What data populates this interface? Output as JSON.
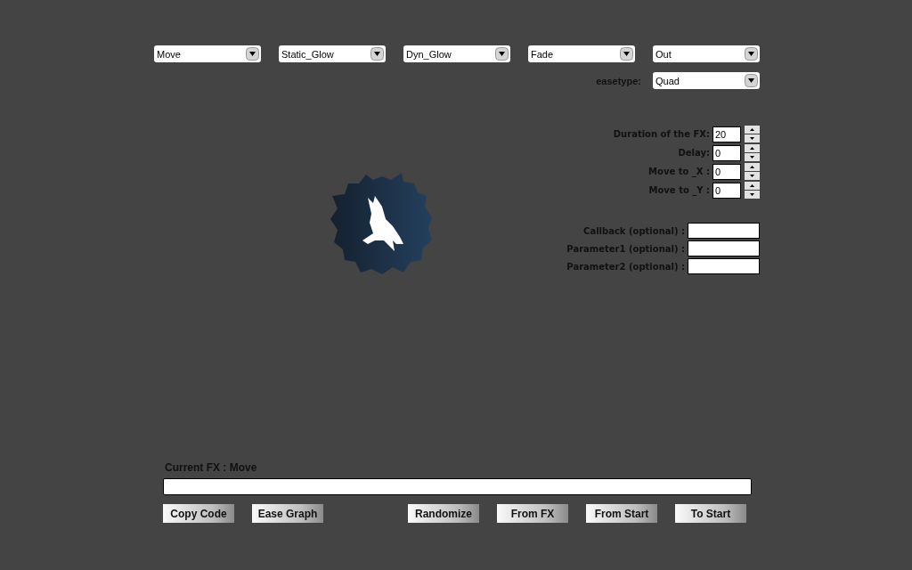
{
  "dropdowns": [
    {
      "value": "Move"
    },
    {
      "value": "Static_Glow"
    },
    {
      "value": "Dyn_Glow"
    },
    {
      "value": "Fade"
    },
    {
      "value": "Out"
    }
  ],
  "easetype": {
    "label": "easetype:",
    "value": "Quad"
  },
  "spinners": [
    {
      "label": "Duration of the FX:",
      "value": "20"
    },
    {
      "label": "Delay:",
      "value": "0"
    },
    {
      "label": "Move to _X :",
      "value": "0"
    },
    {
      "label": "Move to _Y :",
      "value": "0"
    }
  ],
  "optional_fields": [
    {
      "label": "Callback (optional) :"
    },
    {
      "label": "Parameter1 (optional) :"
    },
    {
      "label": "Parameter2 (optional) :"
    }
  ],
  "current_fx": "Current FX : Move",
  "buttons_left": [
    "Copy Code",
    "Ease Graph"
  ],
  "buttons_right": [
    "Randomize",
    "From FX",
    "From Start",
    "To Start"
  ]
}
